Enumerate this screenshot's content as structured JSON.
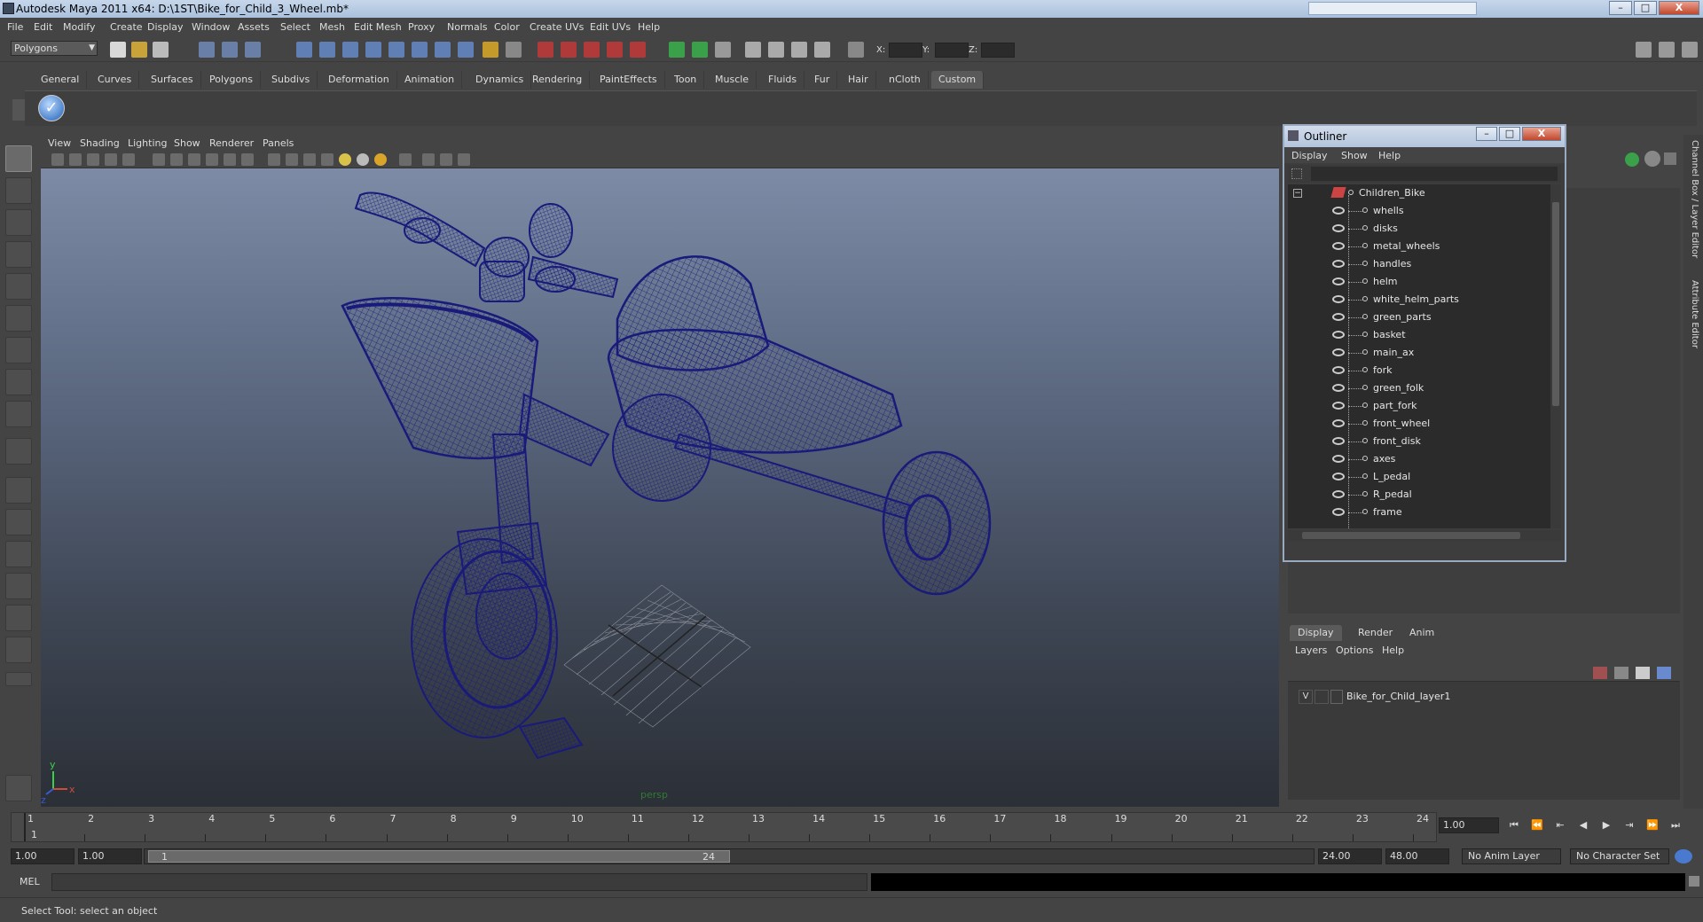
{
  "window": {
    "title": "Autodesk Maya 2011 x64: D:\\1ST\\Bike_for_Child_3_Wheel.mb*",
    "controls": {
      "minimize": "–",
      "maximize": "□",
      "close": "X"
    }
  },
  "menubar": [
    "File",
    "Edit",
    "Modify",
    "Create",
    "Display",
    "Window",
    "Assets",
    "Select",
    "Mesh",
    "Edit Mesh",
    "Proxy",
    "Normals",
    "Color",
    "Create UVs",
    "Edit UVs",
    "Help"
  ],
  "statusline": {
    "mode": "Polygons",
    "coord_labels": [
      "X:",
      "Y:",
      "Z:"
    ]
  },
  "shelf": {
    "tabs": [
      "General",
      "Curves",
      "Surfaces",
      "Polygons",
      "Subdivs",
      "Deformation",
      "Animation",
      "Dynamics",
      "Rendering",
      "PaintEffects",
      "Toon",
      "Muscle",
      "Fluids",
      "Fur",
      "Hair",
      "nCloth",
      "Custom"
    ],
    "active_tab": "Custom"
  },
  "viewport": {
    "menus": [
      "View",
      "Shading",
      "Lighting",
      "Show",
      "Renderer",
      "Panels"
    ],
    "camera_label": "persp",
    "axis_labels": {
      "x": "x",
      "y": "y",
      "z": "z"
    },
    "wire_color": "#1a1a7a"
  },
  "outliner": {
    "title": "Outliner",
    "menus": [
      "Display",
      "Show",
      "Help"
    ],
    "root": "Children_Bike",
    "items": [
      "whells",
      "disks",
      "metal_wheels",
      "handles",
      "helm",
      "white_helm_parts",
      "green_parts",
      "basket",
      "main_ax",
      "fork",
      "green_folk",
      "part_fork",
      "front_wheel",
      "front_disk",
      "axes",
      "L_pedal",
      "R_pedal",
      "frame"
    ]
  },
  "right_panel": {
    "side_tabs": [
      "Channel Box / Layer Editor",
      "Attribute Editor"
    ],
    "layer_tabs": [
      "Display",
      "Render",
      "Anim"
    ],
    "active_layer_tab": "Display",
    "layer_menus": [
      "Layers",
      "Options",
      "Help"
    ],
    "layers": [
      {
        "visible": "V",
        "name": "Bike_for_Child_layer1"
      }
    ]
  },
  "timeslider": {
    "labels": [
      "1",
      "2",
      "3",
      "4",
      "5",
      "6",
      "7",
      "8",
      "9",
      "10",
      "11",
      "12",
      "13",
      "14",
      "15",
      "16",
      "17",
      "18",
      "19",
      "20",
      "21",
      "22",
      "23",
      "24"
    ],
    "current_marker": "1",
    "current_frame": "1.00"
  },
  "range": {
    "start": "1.00",
    "anim_start": "1.00",
    "slider_start": "1",
    "slider_end": "24",
    "anim_end": "24.00",
    "end": "48.00",
    "anim_layer": "No Anim Layer",
    "character_set": "No Character Set"
  },
  "cmdline": {
    "label": "MEL"
  },
  "helpline": {
    "text": "Select Tool: select an object"
  }
}
